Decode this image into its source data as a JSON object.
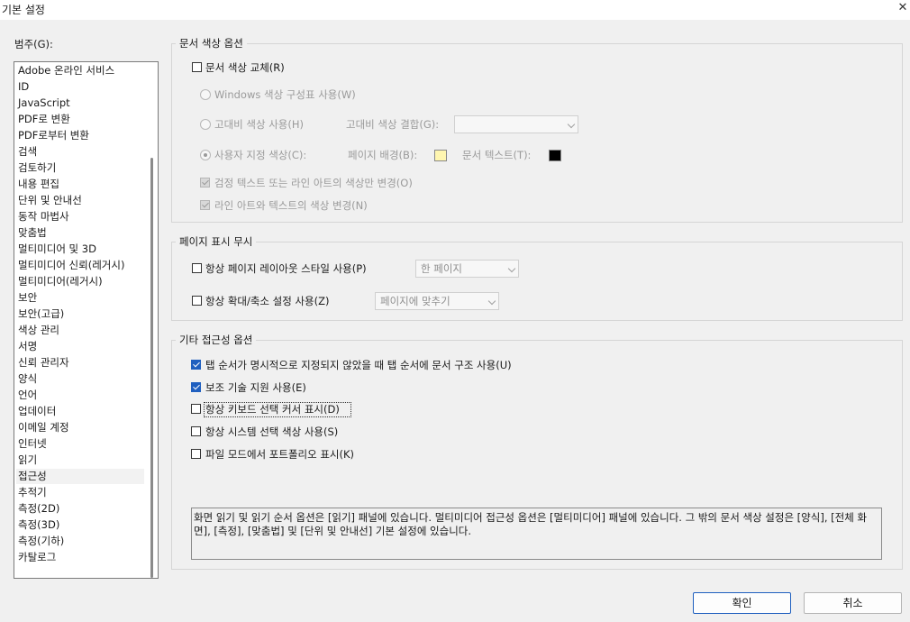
{
  "window": {
    "title": "기본 설정"
  },
  "categories": {
    "label": "범주(G):",
    "items": [
      "Adobe 온라인 서비스",
      "ID",
      "JavaScript",
      "PDF로 변환",
      "PDF로부터 변환",
      "검색",
      "검토하기",
      "내용 편집",
      "단위 및 안내선",
      "동작 마법사",
      "맞춤법",
      "멀티미디어 및 3D",
      "멀티미디어 신뢰(레거시)",
      "멀티미디어(레거시)",
      "보안",
      "보안(고급)",
      "색상 관리",
      "서명",
      "신뢰 관리자",
      "양식",
      "언어",
      "업데이터",
      "이메일 계정",
      "인터넷",
      "읽기",
      "접근성",
      "추적기",
      "측정(2D)",
      "측정(3D)",
      "측정(기하)",
      "카탈로그"
    ],
    "selected": "접근성"
  },
  "doc_colors": {
    "legend": "문서 색상 옵션",
    "replace_label": "문서 색상 교체(R)",
    "windows_label": "Windows 색상 구성표 사용(W)",
    "high_contrast_label": "고대비 색상 사용(H)",
    "high_contrast_combo_label": "고대비 색상 결합(G):",
    "high_contrast_combo_value": "",
    "custom_label": "사용자 지정 색상(C):",
    "page_bg_label": "페이지 배경(B):",
    "page_bg_color": "#fff6b0",
    "doc_text_label": "문서 텍스트(T):",
    "doc_text_color": "#000000",
    "black_text_only_label": "검정 텍스트 또는 라인 아트의 색상만 변경(O)",
    "line_art_label": "라인 아트와 텍스트의 색상 변경(N)"
  },
  "page_display": {
    "legend": "페이지 표시 무시",
    "layout_label": "항상 페이지 레이아웃 스타일 사용(P)",
    "layout_value": "한 페이지",
    "zoom_label": "항상 확대/축소 설정 사용(Z)",
    "zoom_value": "페이지에 맞추기"
  },
  "other_access": {
    "legend": "기타 접근성 옵션",
    "tab_order_label": "탭 순서가 명시적으로 지정되지 않았을 때 탭 순서에 문서 구조 사용(U)",
    "tab_order_checked": true,
    "assistive_label": "보조 기술 지원 사용(E)",
    "assistive_checked": true,
    "keyboard_cursor_label": "항상 키보드 선택 커서 표시(D)",
    "system_color_label": "항상 시스템 선택 색상 사용(S)",
    "portfolio_label": "파일 모드에서 포트폴리오 표시(K)"
  },
  "info_text": "화면 읽기 및 읽기 순서 옵션은 [읽기] 패널에 있습니다. 멀티미디어 접근성 옵션은 [멀티미디어] 패널에 있습니다. 그 밖의 문서 색상 설정은 [양식], [전체 화면], [측정], [맞춤법] 및 [단위 및 안내선] 기본 설정에 있습니다.",
  "buttons": {
    "ok": "확인",
    "cancel": "취소"
  }
}
